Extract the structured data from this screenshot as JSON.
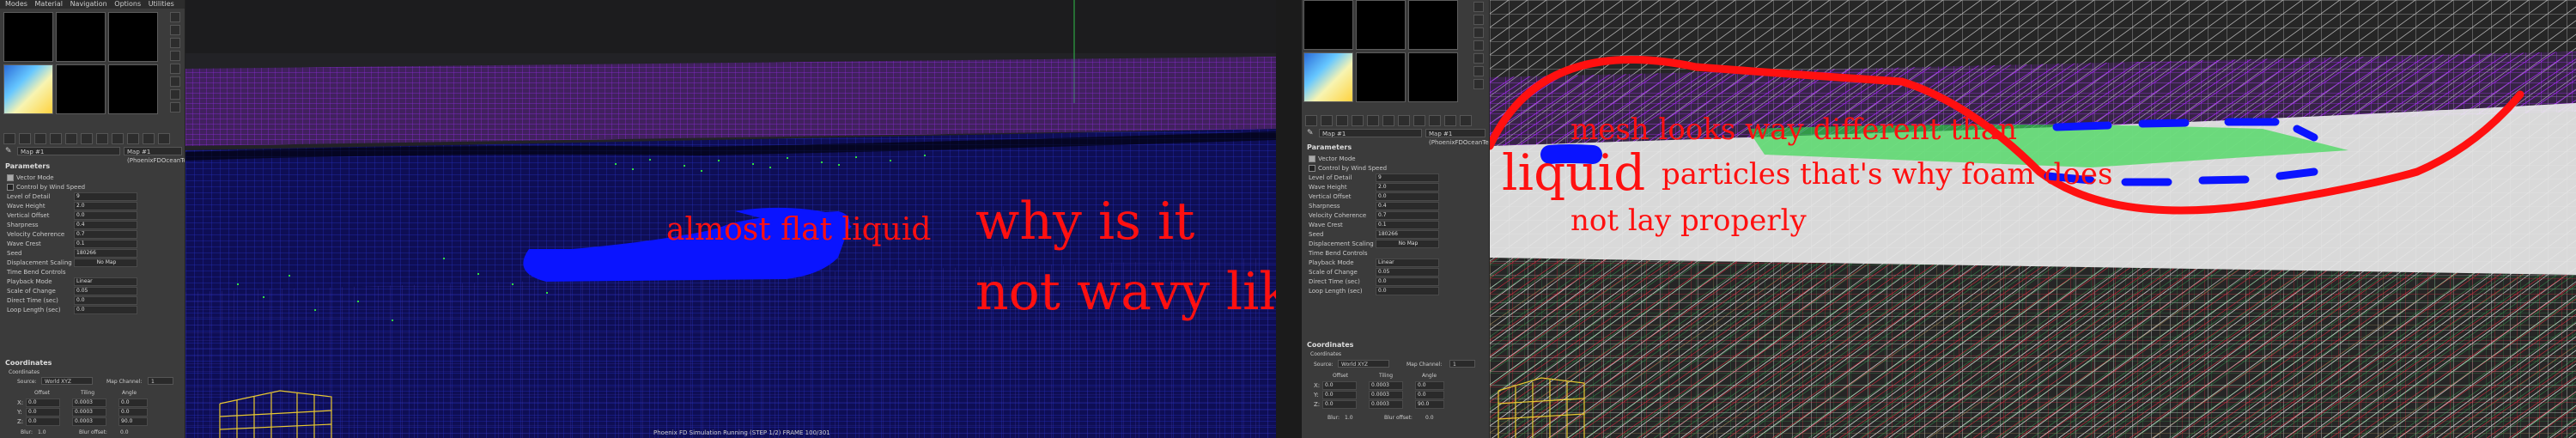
{
  "menu": [
    "Modes",
    "Material",
    "Navigation",
    "Options",
    "Utilities"
  ],
  "material_dropdown": "Map #1",
  "map_type": "Map #1 (PhoenixFDOceanTex)",
  "parameters": {
    "title": "Parameters",
    "vector_mode": "Vector Mode",
    "control_wind_speed": "Control by Wind Speed",
    "rows": [
      {
        "label": "Level of Detail",
        "value": "9"
      },
      {
        "label": "Wave Height",
        "value": "2.0"
      },
      {
        "label": "Vertical Offset",
        "value": "0.0"
      },
      {
        "label": "Sharpness",
        "value": "0.4"
      },
      {
        "label": "Velocity Coherence",
        "value": "0.7"
      },
      {
        "label": "Wave Crest",
        "value": "0.1"
      },
      {
        "label": "Seed",
        "value": "180266"
      }
    ],
    "displacement_scaling": "Displacement Scaling",
    "displacement_map": "No Map",
    "time_bend": "Time Bend Controls",
    "playback_mode": "Playback Mode",
    "playback_value": "Linear",
    "time_rows": [
      {
        "label": "Scale of Change",
        "value": "0.05"
      },
      {
        "label": "Direct Time (sec)",
        "value": "0.0"
      },
      {
        "label": "Loop Length (sec)",
        "value": "0.0"
      }
    ]
  },
  "coordinates": {
    "title": "Coordinates",
    "sub": "Coordinates",
    "source_label": "Source:",
    "source_value": "World XYZ",
    "map_channel": "Map Channel:",
    "map_channel_value": "1",
    "headers": [
      "Offset",
      "Tiling",
      "Angle"
    ],
    "rows": [
      {
        "axis": "X:",
        "offset": "0.0",
        "tiling": "0.0003",
        "angle": "0.0"
      },
      {
        "axis": "Y:",
        "offset": "0.0",
        "tiling": "0.0003",
        "angle": "0.0"
      },
      {
        "axis": "Z:",
        "offset": "0.0",
        "tiling": "0.0003",
        "angle": "90.0"
      }
    ],
    "blur": "Blur:",
    "blur_value": "1.0",
    "blur_offset": "Blur offset:",
    "blur_offset_value": "0.0"
  },
  "status_bar": "Phoenix FD Simulation Running (STEP 1/2) FRAME 100/301",
  "annotations": {
    "almost_flat": "almost flat liquid",
    "why_is_it": "why is it",
    "not_wavy": "not wavy like mesh",
    "liquid": "liquid",
    "mesh_looks": "mesh looks way different than",
    "particles": "particles that's why foam does",
    "not_lay": "not lay properly"
  },
  "colors": {
    "annotation_red": "#ff1010",
    "brush_blue": "#0a14ff",
    "mesh_purple": "#b030ff",
    "particles_green": "#30ff40",
    "ui_bg": "#3b3b3b"
  }
}
